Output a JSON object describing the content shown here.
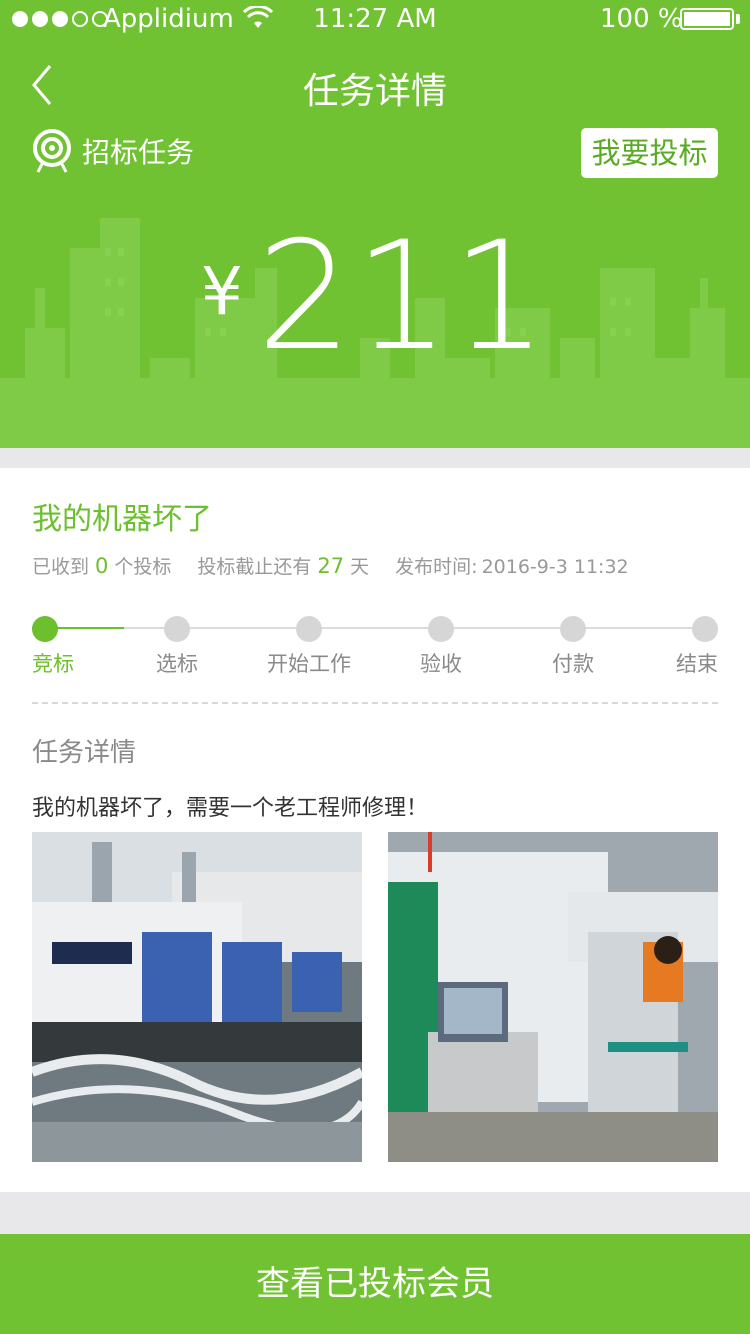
{
  "status_bar": {
    "carrier": "Applidium",
    "time": "11:27 AM",
    "battery": "100 %"
  },
  "nav": {
    "title": "任务详情",
    "back_icon": "chevron-left-icon"
  },
  "task_type": {
    "icon": "target-icon",
    "label": "招标任务"
  },
  "bid_button": "我要投标",
  "price": {
    "currency": "¥",
    "amount": "211"
  },
  "task": {
    "title": "我的机器坏了",
    "received_prefix": "已收到",
    "received_count": "0",
    "received_suffix": "个投标",
    "deadline_prefix": "投标截止还有",
    "deadline_days": "27",
    "deadline_suffix": "天",
    "publish_label": "发布时间:",
    "publish_time": "2016-9-3 11:32"
  },
  "progress": {
    "current_index": 0,
    "steps": [
      "竞标",
      "选标",
      "开始工作",
      "验收",
      "付款",
      "结束"
    ]
  },
  "details": {
    "section_title": "任务详情",
    "description": "我的机器坏了，需要一个老工程师修理！",
    "photos": [
      "injection-molding-machines-photo",
      "machine-operator-photo"
    ]
  },
  "bottom_button": "查看已投标会员",
  "colors": {
    "brand_green": "#70c232",
    "accent_green": "#6cbf2d",
    "muted_text": "#999999"
  }
}
